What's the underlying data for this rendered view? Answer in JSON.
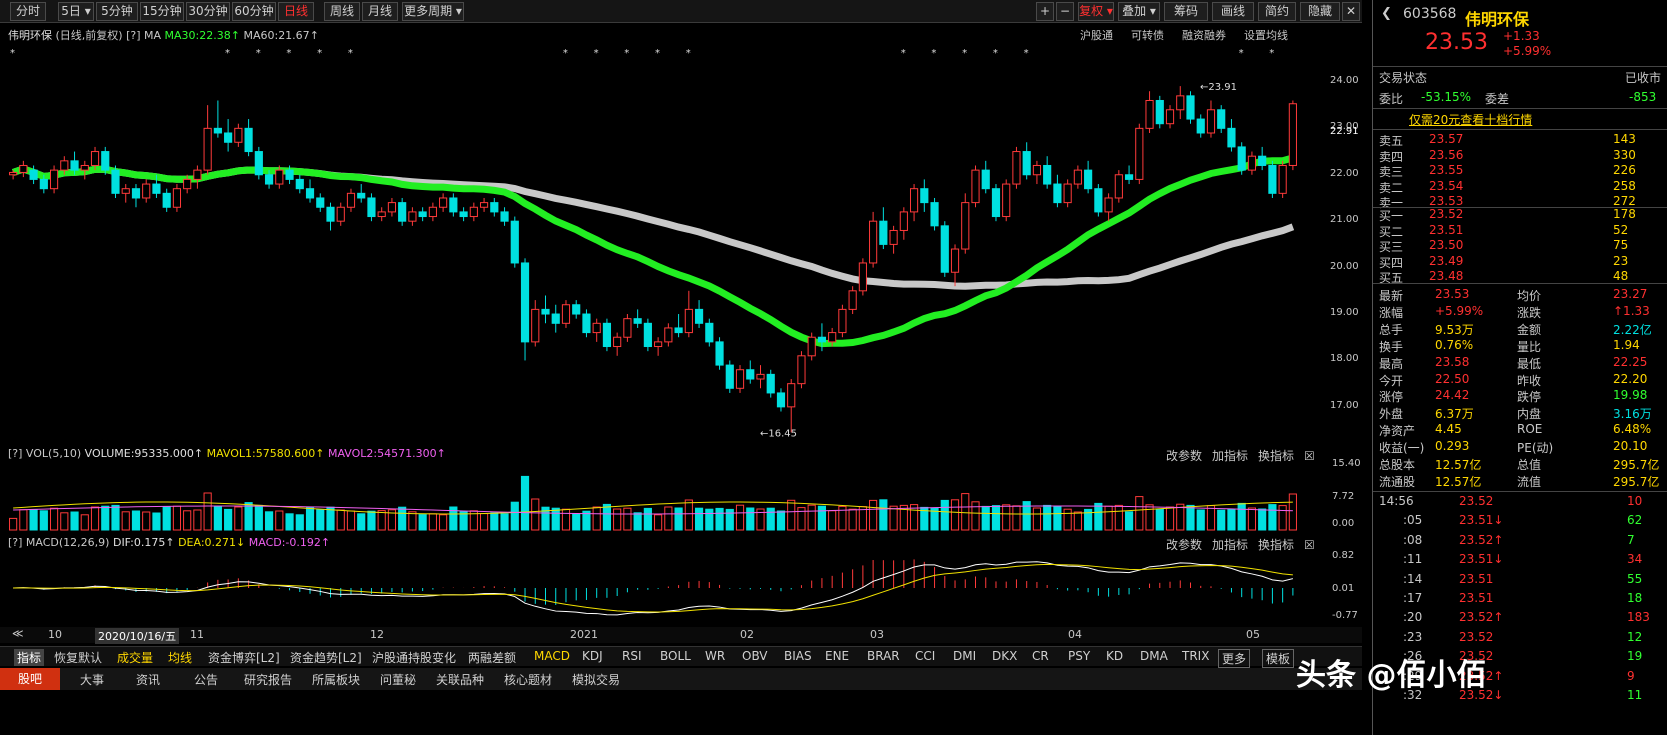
{
  "toolbar": {
    "tabs": [
      "分时",
      "5日",
      "5分钟",
      "15分钟",
      "30分钟",
      "60分钟",
      "日线",
      "周线",
      "月线",
      "更多周期"
    ],
    "right": [
      "+",
      "−",
      "复权",
      "叠加",
      "筹码",
      "画线",
      "简约",
      "隐藏"
    ]
  },
  "header": {
    "stock": "伟明环保",
    "mode": "(日线,前复权)",
    "ma_label": "MA",
    "ma30": "MA30:22.38",
    "ma60": "MA60:21.67",
    "links": [
      "沪股通",
      "可转债",
      "融资融券",
      "设置均线"
    ]
  },
  "price_axis": [
    "24.00",
    "23.00",
    "22.91",
    "22.00",
    "21.00",
    "20.00",
    "19.00",
    "18.00",
    "17.00"
  ],
  "annotations": {
    "high": "23.91",
    "low": "16.45"
  },
  "vol": {
    "label": "VOL(5,10)",
    "volume": "VOLUME:95335.000",
    "mavol1": "MAVOL1:57580.600",
    "mavol2": "MAVOL2:54571.300",
    "axis": [
      "15.40",
      "7.72",
      "0.00"
    ],
    "btns": [
      "改参数",
      "加指标",
      "换指标"
    ]
  },
  "macd": {
    "label": "MACD(12,26,9)",
    "dif": "DIF:0.175",
    "dea": "DEA:0.271",
    "macd": "MACD:-0.192",
    "axis": [
      "0.82",
      "0.01",
      "-0.77"
    ],
    "btns": [
      "改参数",
      "加指标",
      "换指标"
    ]
  },
  "dates": [
    "10",
    "2020/10/16/五",
    "11",
    "12",
    "2021",
    "02",
    "03",
    "04",
    "05"
  ],
  "indicators": [
    "指标",
    "恢复默认",
    "成交量",
    "均线",
    "资金博弈[L2]",
    "资金趋势[L2]",
    "沪股通持股变化",
    "两融差额",
    "MACD",
    "KDJ",
    "RSI",
    "BOLL",
    "WR",
    "OBV",
    "BIAS",
    "ENE",
    "BRAR",
    "CCI",
    "DMI",
    "DKX",
    "CR",
    "PSY",
    "KD",
    "DMA",
    "TRIX",
    "更多",
    "模板"
  ],
  "footer": [
    "股吧",
    "大事",
    "资讯",
    "公告",
    "研究报告",
    "所属板块",
    "问董秘",
    "关联品种",
    "核心题材",
    "模拟交易"
  ],
  "quote": {
    "code": "603568",
    "name": "伟明环保",
    "price": "23.53",
    "change": "+1.33",
    "pct": "+5.99%",
    "status_label": "交易状态",
    "status": "已收市",
    "ratio_label": "委比",
    "ratio": "-53.15%",
    "diff_label": "委差",
    "diff": "-853",
    "promo": "仅需20元查看十档行情"
  },
  "asks": [
    [
      "卖五",
      "23.57",
      "143"
    ],
    [
      "卖四",
      "23.56",
      "330"
    ],
    [
      "卖三",
      "23.55",
      "226"
    ],
    [
      "卖二",
      "23.54",
      "258"
    ],
    [
      "卖一",
      "23.53",
      "272"
    ]
  ],
  "bids": [
    [
      "买一",
      "23.52",
      "178"
    ],
    [
      "买二",
      "23.51",
      "52"
    ],
    [
      "买三",
      "23.50",
      "75"
    ],
    [
      "买四",
      "23.49",
      "23"
    ],
    [
      "买五",
      "23.48",
      "48"
    ]
  ],
  "stats": [
    [
      "最新",
      "23.53",
      "均价",
      "23.27"
    ],
    [
      "涨幅",
      "+5.99%",
      "涨跌",
      "↑1.33"
    ],
    [
      "总手",
      "9.53万",
      "金额",
      "2.22亿"
    ],
    [
      "换手",
      "0.76%",
      "量比",
      "1.94"
    ],
    [
      "最高",
      "23.58",
      "最低",
      "22.25"
    ],
    [
      "今开",
      "22.50",
      "昨收",
      "22.20"
    ],
    [
      "涨停",
      "24.42",
      "跌停",
      "19.98"
    ],
    [
      "外盘",
      "6.37万",
      "内盘",
      "3.16万"
    ],
    [
      "净资产",
      "4.45",
      "ROE",
      "6.48%"
    ],
    [
      "收益(一)",
      "0.293",
      "PE(动)",
      "20.10"
    ],
    [
      "总股本",
      "12.57亿",
      "总值",
      "295.7亿"
    ],
    [
      "流通股",
      "12.57亿",
      "流值",
      "295.7亿"
    ]
  ],
  "ticks": [
    [
      "14:56",
      "23.52",
      "10"
    ],
    [
      ":05",
      "23.51↓",
      "62"
    ],
    [
      ":08",
      "23.52↑",
      "7"
    ],
    [
      ":11",
      "23.51↓",
      "34"
    ],
    [
      ":14",
      "23.51",
      "55"
    ],
    [
      ":17",
      "23.51",
      "18"
    ],
    [
      ":20",
      "23.52↑",
      "183"
    ],
    [
      ":23",
      "23.52",
      "12"
    ],
    [
      ":26",
      "23.52",
      "19"
    ],
    [
      ":29",
      "23.52↑",
      "9"
    ],
    [
      ":32",
      "23.52↓",
      "11"
    ]
  ],
  "watermark": "头条 @佰小佰",
  "chart_data": {
    "type": "candlestick",
    "title": "伟明环保 日线",
    "y_axis": [
      17,
      24
    ],
    "ohlc": [
      [
        22.0,
        22.1,
        21.9,
        22.05
      ],
      [
        22.05,
        22.3,
        21.95,
        22.2
      ],
      [
        22.1,
        22.2,
        21.8,
        21.9
      ],
      [
        21.9,
        22.0,
        21.6,
        21.7
      ],
      [
        21.7,
        22.2,
        21.6,
        22.1
      ],
      [
        22.1,
        22.4,
        22.0,
        22.3
      ],
      [
        22.3,
        22.5,
        22.0,
        22.1
      ],
      [
        22.1,
        22.3,
        21.9,
        22.2
      ],
      [
        22.2,
        22.6,
        22.1,
        22.5
      ],
      [
        22.5,
        22.6,
        22.0,
        22.1
      ],
      [
        22.1,
        22.2,
        21.5,
        21.6
      ],
      [
        21.6,
        21.8,
        21.4,
        21.7
      ],
      [
        21.7,
        21.8,
        21.3,
        21.5
      ],
      [
        21.5,
        21.9,
        21.4,
        21.8
      ],
      [
        21.8,
        22.0,
        21.5,
        21.6
      ],
      [
        21.6,
        21.7,
        21.2,
        21.3
      ],
      [
        21.3,
        21.8,
        21.2,
        21.7
      ],
      [
        21.7,
        22.0,
        21.6,
        21.9
      ],
      [
        21.9,
        22.2,
        21.7,
        22.1
      ],
      [
        22.1,
        23.5,
        22.0,
        23.0
      ],
      [
        23.0,
        23.6,
        22.8,
        22.9
      ],
      [
        22.9,
        23.2,
        22.5,
        22.7
      ],
      [
        22.7,
        23.1,
        22.6,
        23.0
      ],
      [
        23.0,
        23.2,
        22.4,
        22.5
      ],
      [
        22.5,
        22.6,
        21.9,
        22.0
      ],
      [
        22.0,
        22.1,
        21.7,
        21.8
      ],
      [
        21.8,
        22.2,
        21.7,
        22.1
      ],
      [
        22.1,
        22.2,
        21.8,
        21.9
      ],
      [
        21.9,
        22.0,
        21.6,
        21.7
      ],
      [
        21.7,
        21.9,
        21.4,
        21.5
      ],
      [
        21.5,
        21.6,
        21.2,
        21.3
      ],
      [
        21.3,
        21.4,
        20.8,
        21.0
      ],
      [
        21.0,
        21.4,
        20.9,
        21.3
      ],
      [
        21.3,
        21.7,
        21.2,
        21.6
      ],
      [
        21.6,
        21.8,
        21.4,
        21.5
      ],
      [
        21.5,
        21.6,
        21.0,
        21.1
      ],
      [
        21.1,
        21.3,
        21.0,
        21.2
      ],
      [
        21.2,
        21.5,
        21.1,
        21.4
      ],
      [
        21.4,
        21.5,
        20.9,
        21.0
      ],
      [
        21.0,
        21.3,
        20.9,
        21.2
      ],
      [
        21.2,
        21.3,
        21.0,
        21.1
      ],
      [
        21.1,
        21.4,
        21.0,
        21.3
      ],
      [
        21.3,
        21.6,
        21.2,
        21.5
      ],
      [
        21.5,
        21.6,
        21.1,
        21.2
      ],
      [
        21.2,
        21.3,
        21.0,
        21.1
      ],
      [
        21.1,
        21.4,
        21.0,
        21.3
      ],
      [
        21.3,
        21.5,
        21.2,
        21.4
      ],
      [
        21.4,
        21.5,
        21.1,
        21.2
      ],
      [
        21.2,
        21.3,
        20.9,
        21.0
      ],
      [
        21.0,
        21.1,
        20.0,
        20.1
      ],
      [
        20.1,
        20.2,
        18.0,
        18.4
      ],
      [
        18.4,
        19.3,
        18.3,
        19.1
      ],
      [
        19.1,
        19.4,
        18.8,
        19.0
      ],
      [
        19.0,
        19.2,
        18.6,
        18.8
      ],
      [
        18.8,
        19.3,
        18.7,
        19.2
      ],
      [
        19.2,
        19.3,
        18.9,
        19.0
      ],
      [
        19.0,
        19.1,
        18.5,
        18.6
      ],
      [
        18.6,
        18.9,
        18.4,
        18.8
      ],
      [
        18.8,
        18.9,
        18.2,
        18.3
      ],
      [
        18.3,
        18.6,
        18.1,
        18.5
      ],
      [
        18.5,
        19.0,
        18.4,
        18.9
      ],
      [
        18.9,
        19.1,
        18.7,
        18.8
      ],
      [
        18.8,
        18.9,
        18.2,
        18.3
      ],
      [
        18.3,
        18.5,
        18.1,
        18.4
      ],
      [
        18.4,
        18.8,
        18.3,
        18.7
      ],
      [
        18.7,
        19.0,
        18.5,
        18.6
      ],
      [
        18.6,
        19.5,
        18.5,
        19.1
      ],
      [
        19.1,
        19.3,
        18.7,
        18.8
      ],
      [
        18.8,
        18.9,
        18.3,
        18.4
      ],
      [
        18.4,
        18.5,
        17.8,
        17.9
      ],
      [
        17.9,
        18.0,
        17.3,
        17.4
      ],
      [
        17.4,
        17.9,
        17.3,
        17.8
      ],
      [
        17.8,
        18.0,
        17.5,
        17.6
      ],
      [
        17.6,
        17.9,
        17.4,
        17.7
      ],
      [
        17.7,
        17.8,
        17.2,
        17.3
      ],
      [
        17.3,
        17.4,
        16.9,
        17.0
      ],
      [
        17.0,
        17.6,
        16.45,
        17.5
      ],
      [
        17.5,
        18.2,
        17.4,
        18.1
      ],
      [
        18.1,
        18.6,
        18.0,
        18.5
      ],
      [
        18.5,
        18.8,
        18.2,
        18.4
      ],
      [
        18.4,
        18.7,
        18.3,
        18.6
      ],
      [
        18.6,
        19.2,
        18.5,
        19.1
      ],
      [
        19.1,
        19.6,
        19.0,
        19.5
      ],
      [
        19.5,
        20.2,
        19.4,
        20.1
      ],
      [
        20.1,
        21.2,
        20.0,
        21.0
      ],
      [
        21.0,
        21.3,
        20.4,
        20.5
      ],
      [
        20.5,
        20.9,
        20.3,
        20.8
      ],
      [
        20.8,
        21.3,
        20.6,
        21.2
      ],
      [
        21.2,
        21.8,
        21.0,
        21.7
      ],
      [
        21.7,
        21.9,
        21.2,
        21.4
      ],
      [
        21.4,
        21.5,
        20.8,
        20.9
      ],
      [
        20.9,
        21.0,
        19.8,
        19.9
      ],
      [
        19.9,
        20.5,
        19.6,
        20.4
      ],
      [
        20.4,
        21.6,
        20.3,
        21.4
      ],
      [
        21.4,
        22.2,
        21.3,
        22.1
      ],
      [
        22.1,
        22.3,
        21.6,
        21.7
      ],
      [
        21.7,
        21.8,
        21.0,
        21.1
      ],
      [
        21.1,
        21.9,
        21.0,
        21.8
      ],
      [
        21.8,
        22.6,
        21.7,
        22.5
      ],
      [
        22.5,
        22.7,
        21.9,
        22.0
      ],
      [
        22.0,
        22.3,
        21.8,
        22.2
      ],
      [
        22.2,
        22.4,
        21.7,
        21.8
      ],
      [
        21.8,
        22.0,
        21.3,
        21.4
      ],
      [
        21.4,
        21.9,
        21.3,
        21.8
      ],
      [
        21.8,
        22.2,
        21.7,
        22.1
      ],
      [
        22.1,
        22.3,
        21.6,
        21.7
      ],
      [
        21.7,
        21.8,
        21.1,
        21.2
      ],
      [
        21.2,
        21.6,
        21.0,
        21.5
      ],
      [
        21.5,
        22.1,
        21.4,
        22.0
      ],
      [
        22.0,
        22.2,
        21.8,
        21.9
      ],
      [
        21.9,
        23.1,
        21.8,
        23.0
      ],
      [
        23.0,
        23.8,
        22.9,
        23.6
      ],
      [
        23.6,
        23.7,
        23.0,
        23.1
      ],
      [
        23.1,
        23.5,
        23.0,
        23.4
      ],
      [
        23.4,
        23.91,
        23.2,
        23.7
      ],
      [
        23.7,
        23.8,
        23.1,
        23.2
      ],
      [
        23.2,
        23.3,
        22.8,
        22.9
      ],
      [
        22.9,
        23.6,
        22.8,
        23.4
      ],
      [
        23.4,
        23.5,
        22.9,
        23.0
      ],
      [
        23.0,
        23.2,
        22.5,
        22.6
      ],
      [
        22.6,
        22.7,
        22.0,
        22.1
      ],
      [
        22.1,
        22.5,
        22.0,
        22.4
      ],
      [
        22.4,
        22.6,
        22.1,
        22.2
      ],
      [
        22.2,
        22.3,
        21.5,
        21.6
      ],
      [
        21.6,
        22.3,
        21.5,
        22.2
      ],
      [
        22.2,
        23.6,
        22.1,
        23.53
      ]
    ]
  }
}
